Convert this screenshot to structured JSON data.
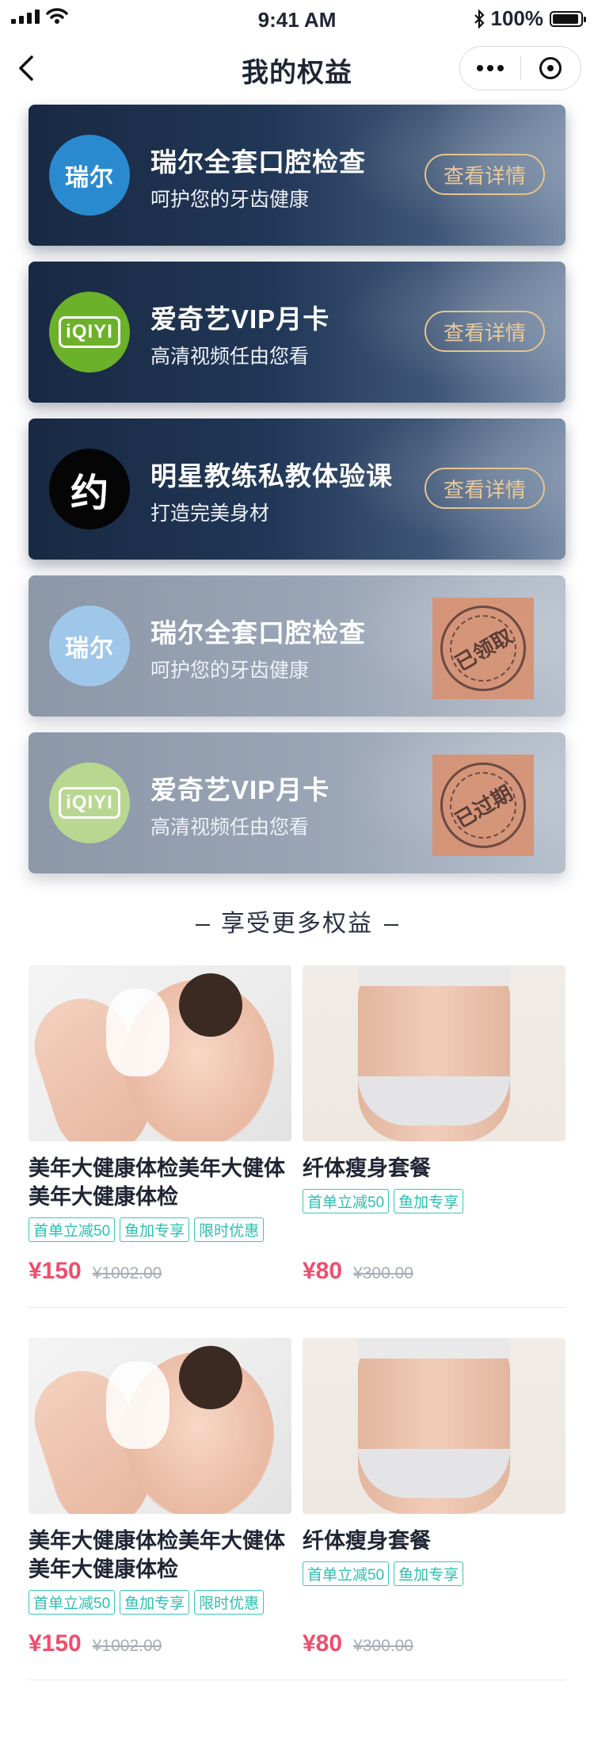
{
  "status_bar": {
    "time": "9:41 AM",
    "battery": "100%"
  },
  "nav": {
    "title": "我的权益"
  },
  "cards": [
    {
      "logo_text": "瑞尔",
      "title": "瑞尔全套口腔检查",
      "subtitle": "呵护您的牙齿健康",
      "action": "查看详情"
    },
    {
      "logo_text": "iQIYI",
      "title": "爱奇艺VIP月卡",
      "subtitle": "高清视频任由您看",
      "action": "查看详情"
    },
    {
      "logo_text": "约",
      "title": "明星教练私教体验课",
      "subtitle": "打造完美身材",
      "action": "查看详情"
    },
    {
      "logo_text": "瑞尔",
      "title": "瑞尔全套口腔检查",
      "subtitle": "呵护您的牙齿健康",
      "stamp": "已领取"
    },
    {
      "logo_text": "iQIYI",
      "title": "爱奇艺VIP月卡",
      "subtitle": "高清视频任由您看",
      "stamp": "已过期"
    }
  ],
  "more_section": {
    "title": "享受更多权益"
  },
  "products": [
    {
      "name": "美年大健康体检美年大健体美年大健康体检",
      "tags": [
        "首单立减50",
        "鱼加专享",
        "限时优惠"
      ],
      "price": "¥150",
      "original_price": "¥1002.00"
    },
    {
      "name": "纤体瘦身套餐",
      "tags": [
        "首单立减50",
        "鱼加专享"
      ],
      "price": "¥80",
      "original_price": "¥300.00"
    },
    {
      "name": "美年大健康体检美年大健体美年大健康体检",
      "tags": [
        "首单立减50",
        "鱼加专享",
        "限时优惠"
      ],
      "price": "¥150",
      "original_price": "¥1002.00"
    },
    {
      "name": "纤体瘦身套餐",
      "tags": [
        "首单立减50",
        "鱼加专享"
      ],
      "price": "¥80",
      "original_price": "¥300.00"
    }
  ],
  "colors": {
    "price": "#f24d6c",
    "tag": "#2cbfae",
    "detail_button": "#e5c48f",
    "card_dark": "#182942"
  }
}
